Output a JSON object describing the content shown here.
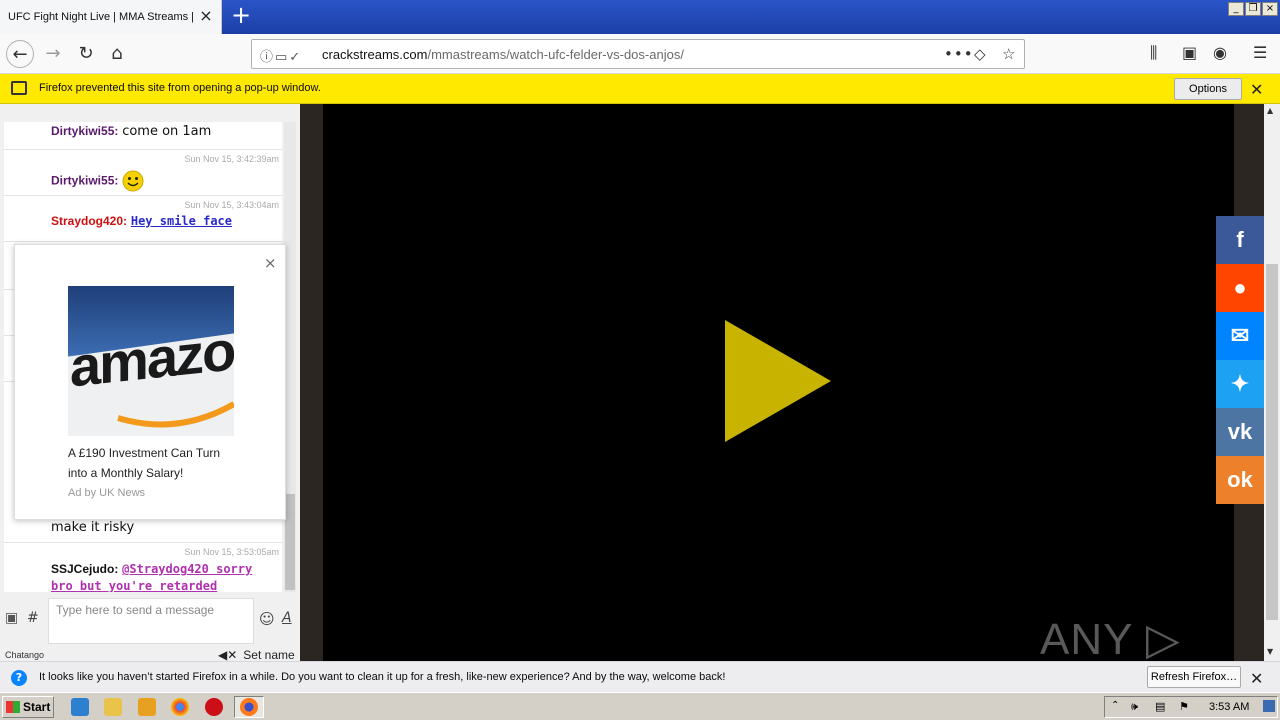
{
  "browser": {
    "tab_title": "UFC Fight Night Live | MMA Streams | U",
    "url_host": "crackstreams.com",
    "url_path": "/mmastreams/watch-ufc-felder-vs-dos-anjos/"
  },
  "popup_bar": {
    "message": "Firefox prevented this site from opening a pop-up window.",
    "options_label": "Options"
  },
  "chat": {
    "messages": [
      {
        "user": "Dirtykiwi55:",
        "text": "come on 1am",
        "time": ""
      },
      {
        "user": "Dirtykiwi55:",
        "text": "",
        "time": "Sun Nov 15, 3:42:39am"
      },
      {
        "user": "Straydog420:",
        "text": "Hey smile face",
        "time": "Sun Nov 15, 3:43:04am"
      },
      {
        "user": "",
        "text": "make it risky",
        "time": ""
      },
      {
        "user": "SSJCejudo:",
        "text": "@Straydog420 sorry bro but you're retarded",
        "time": "Sun Nov 15, 3:53:05am"
      }
    ],
    "input_placeholder": "Type here to send a message",
    "hash_label": "#",
    "brand": "Chatango",
    "set_name": "Set name"
  },
  "ad": {
    "image_text": "amazo",
    "headline": "A £190 Investment Can Turn into a Monthly Salary!",
    "source": "Ad by UK News"
  },
  "social": [
    {
      "name": "facebook",
      "glyph": "f",
      "color": "#3b5998"
    },
    {
      "name": "reddit",
      "glyph": "●",
      "color": "#ff4500"
    },
    {
      "name": "messenger",
      "glyph": "✉",
      "color": "#0084ff"
    },
    {
      "name": "twitter",
      "glyph": "✦",
      "color": "#1da1f2"
    },
    {
      "name": "vk",
      "glyph": "vk",
      "color": "#4c75a3"
    },
    {
      "name": "odnoklassniki",
      "glyph": "ok",
      "color": "#ed812b"
    }
  ],
  "watermark": "ANY ▷ RUN",
  "refresh_bar": {
    "message": "It looks like you haven’t started Firefox in a while. Do you want to clean it up for a fresh, like-new experience? And by the way, welcome back!",
    "button_label": "Refresh Firefox…"
  },
  "taskbar": {
    "start_label": "Start",
    "clock": "3:53 AM"
  },
  "colors": {
    "popup_bar_bg": "#ffe900",
    "play_button": "#c8b400",
    "username_dirtykiwi": "#5a1a6a",
    "username_straydog": "#cc1111",
    "link_blue": "#2a2acc",
    "link_purple": "#b030b0"
  }
}
